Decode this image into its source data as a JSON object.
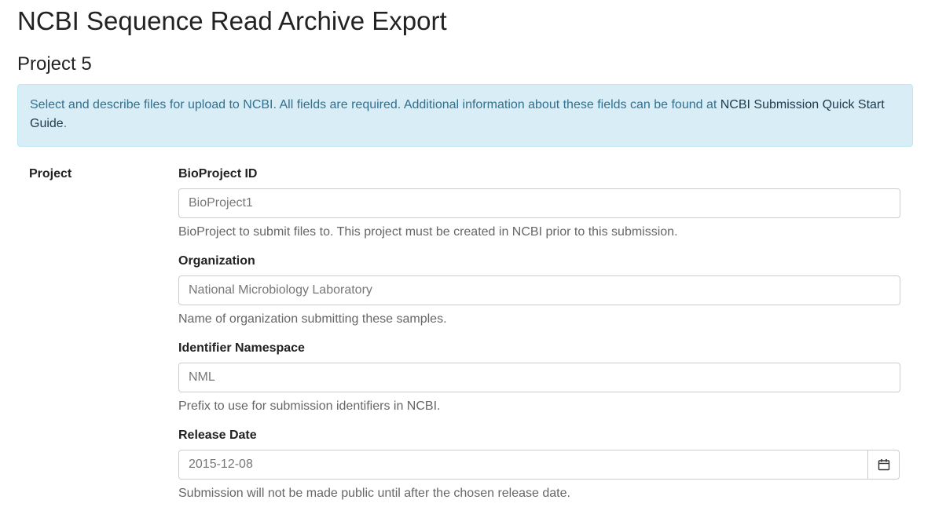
{
  "page": {
    "title": "NCBI Sequence Read Archive Export",
    "section_title": "Project 5"
  },
  "info": {
    "text": "Select and describe files for upload to NCBI. All fields are required. Additional information about these fields can be found at ",
    "link_text": "NCBI Submission Quick Start Guide",
    "suffix": "."
  },
  "form": {
    "row_label": "Project",
    "fields": [
      {
        "label": "BioProject ID",
        "placeholder": "BioProject1",
        "help": "BioProject to submit files to. This project must be created in NCBI prior to this submission."
      },
      {
        "label": "Organization",
        "placeholder": "National Microbiology Laboratory",
        "help": "Name of organization submitting these samples."
      },
      {
        "label": "Identifier Namespace",
        "placeholder": "NML",
        "help": "Prefix to use for submission identifiers in NCBI."
      },
      {
        "label": "Release Date",
        "placeholder": "2015-12-08",
        "help": "Submission will not be made public until after the chosen release date.",
        "icon": "calendar-icon"
      }
    ]
  },
  "colors": {
    "info_bg": "#d9edf7",
    "info_text": "#31708f",
    "info_border": "#bce8f1"
  }
}
